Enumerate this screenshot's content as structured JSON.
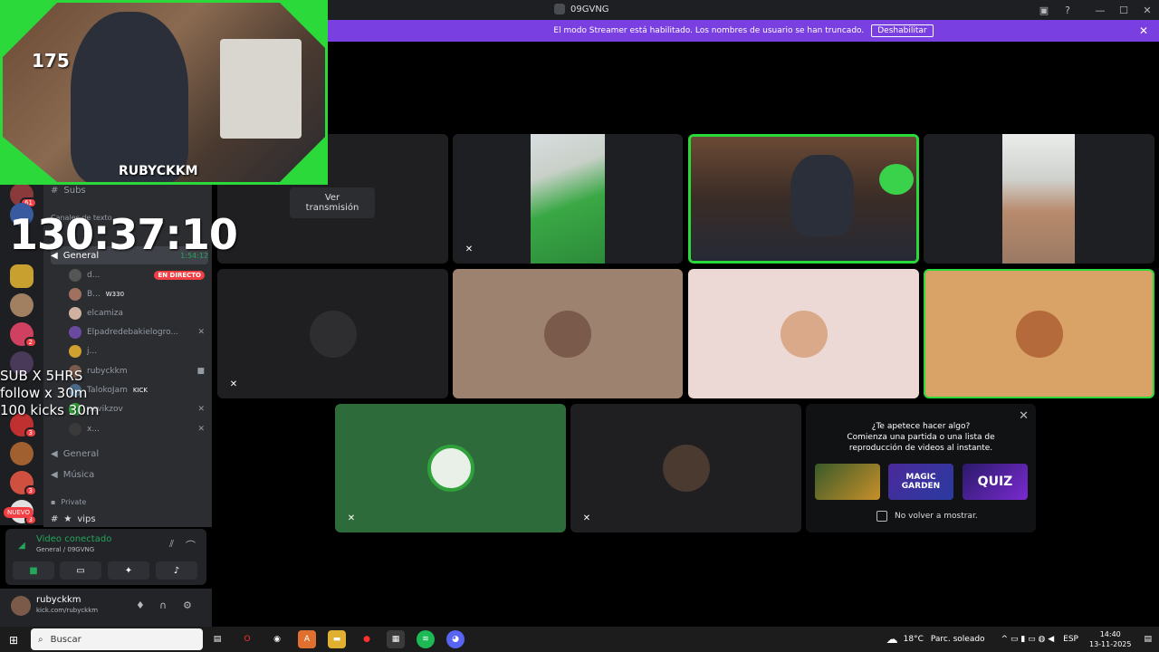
{
  "title_bar": {
    "server_name": "09GVNG"
  },
  "banner": {
    "text": "El modo Streamer está habilitado. Los nombres de usuario se han truncado.",
    "button_label": "Deshabilitar"
  },
  "tooltip": {
    "text": "Ver transmisión"
  },
  "activity": {
    "title": "¿Te apetece hacer algo?",
    "subtitle": "Comienza una partida o una lista de reproducción de videos al instante.",
    "games": [
      "",
      "MAGIC GARDEN",
      "QUIZ"
    ],
    "checkbox_label": "No volver a mostrar."
  },
  "stream_overlay": {
    "count": "175",
    "timer": "130:37:10",
    "line1": "SUB X 5HRS",
    "line2": "follow x 30m",
    "line3": "100 kicks 30m",
    "cam_name": "RUBYCKKM"
  },
  "servers": {
    "badges": [
      "61",
      "2",
      "3",
      "3",
      "3"
    ],
    "new_badge": "NUEVO"
  },
  "channels": {
    "subs": "Subs",
    "category": "Canales de texto",
    "general_active": "General",
    "general_time": "1:54:12",
    "users": [
      {
        "name": "d...",
        "tag": "EN DIRECTO"
      },
      {
        "name": "B...",
        "tag": "W330"
      },
      {
        "name": "elcamiza",
        "tag": ""
      },
      {
        "name": "Elpadredebakielogro...",
        "tag": ""
      },
      {
        "name": "j...",
        "tag": ""
      },
      {
        "name": "rubyckkm",
        "tag": ""
      },
      {
        "name": "TalokoJam",
        "tag": "KICK"
      },
      {
        "name": "nevikzov",
        "tag": ""
      },
      {
        "name": "x...",
        "tag": ""
      }
    ],
    "general2": "General",
    "musica": "Música",
    "private": "Private",
    "vips": "vips"
  },
  "voice_panel": {
    "status": "Video conectado",
    "location": "General / 09GVNG"
  },
  "user": {
    "name": "rubyckkm",
    "sub": "kick.com/rubyckkm"
  },
  "taskbar": {
    "search_placeholder": "Buscar",
    "weather_temp": "18°C",
    "weather_desc": "Parc. soleado",
    "lang": "ESP",
    "time": "14:40",
    "date": "13-11-2025"
  },
  "colors": {
    "accent": "#7a3fe0",
    "green": "#2cd93a",
    "live_red": "#f23f43"
  }
}
